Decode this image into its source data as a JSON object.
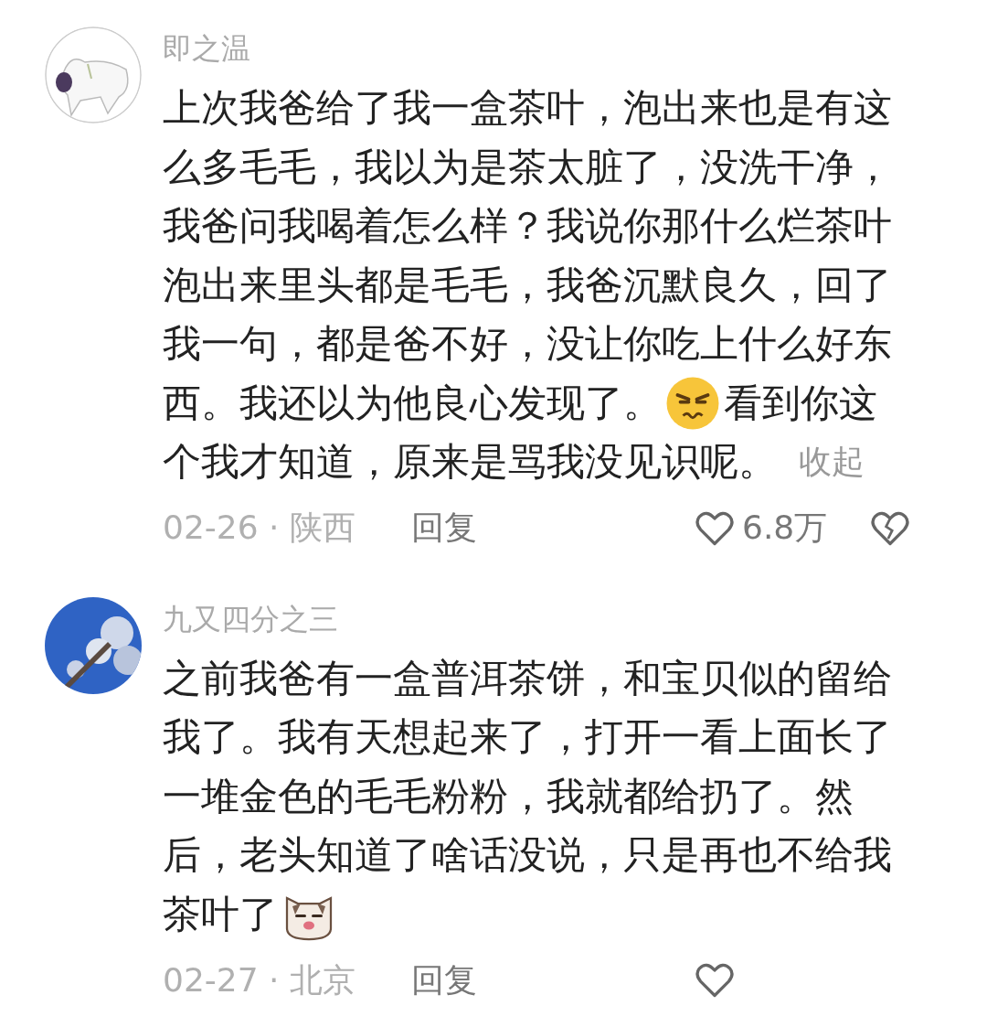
{
  "comments": [
    {
      "username": "即之温",
      "avatar": {
        "kind": "picture"
      },
      "lines": [
        [
          {
            "kind": "text",
            "text": "上次我爸给了我一盒茶叶，泡出来也是有这"
          }
        ],
        [
          {
            "kind": "text",
            "text": "么多毛毛，我以为是茶太脏了，没洗干净，"
          }
        ],
        [
          {
            "kind": "text",
            "text": "我爸问我喝着怎么样？我说你那什么烂茶叶"
          }
        ],
        [
          {
            "kind": "text",
            "text": "泡出来里头都是毛毛，我爸沉默良久，回了"
          }
        ],
        [
          {
            "kind": "text",
            "text": "我一句，都是爸不好，没让你吃上什么好东"
          }
        ],
        [
          {
            "kind": "text",
            "text": "西。我还以为他良心发现了。"
          },
          {
            "kind": "annoyed_emoji"
          },
          {
            "kind": "text",
            "text": "看到你这"
          }
        ],
        [
          {
            "kind": "text",
            "text": "个我才知道，原来是骂我没见识呢。"
          },
          {
            "kind": "toggle",
            "text": "收起"
          }
        ]
      ],
      "date_location": "02-26 · 陕西",
      "reply": "回复",
      "likes": "6.8万",
      "dislike": true
    },
    {
      "username": "九又四分之三",
      "avatar": {
        "kind": "picture"
      },
      "lines": [
        [
          {
            "kind": "text",
            "text": "之前我爸有一盒普洱茶饼，和宝贝似的留给"
          }
        ],
        [
          {
            "kind": "text",
            "text": "我了。我有天想起来了，打开一看上面长了"
          }
        ],
        [
          {
            "kind": "text",
            "text": "一堆金色的毛毛粉粉，我就都给扔了。然"
          }
        ],
        [
          {
            "kind": "text",
            "text": "后，老头知道了啥话没说，只是再也不给我"
          }
        ],
        [
          {
            "kind": "text",
            "text": "茶叶了"
          },
          {
            "kind": "cat_emoji"
          }
        ]
      ],
      "date_location": "02-27 · 北京",
      "reply": "回复",
      "dislike": false
    }
  ]
}
